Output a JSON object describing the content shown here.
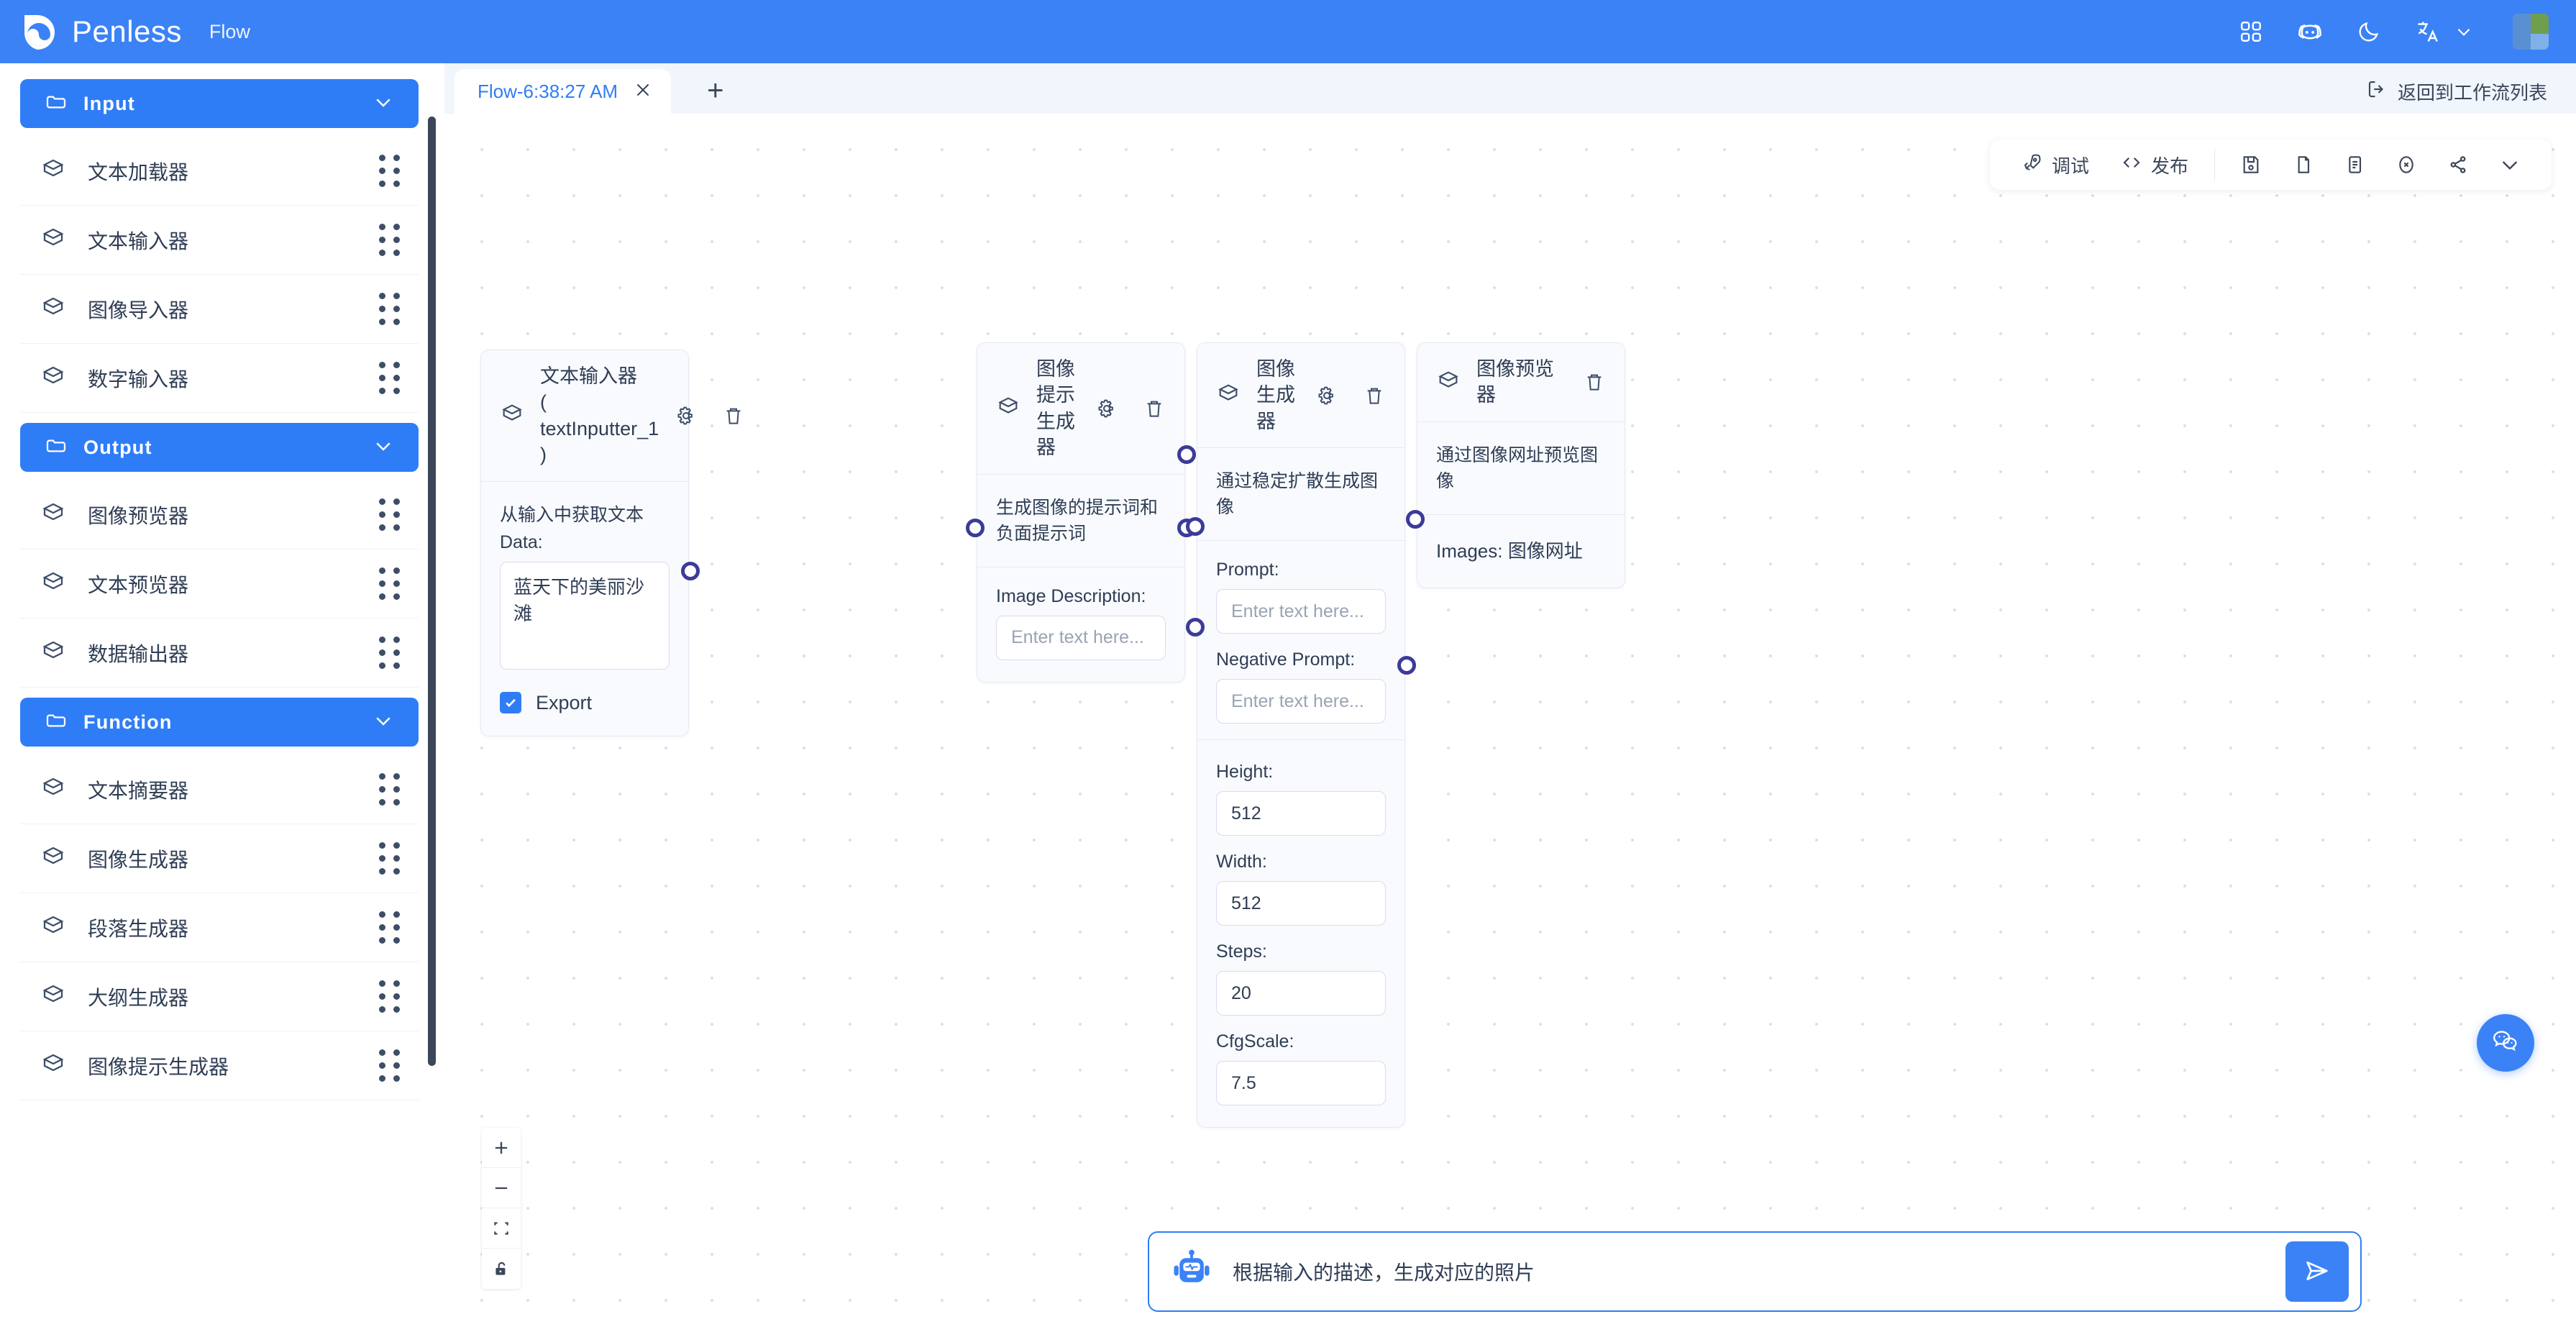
{
  "header": {
    "brand": "Penless",
    "product": "Flow",
    "icons": [
      "apps-grid-icon",
      "discord-icon",
      "dark-mode-moon-icon",
      "translate-icon",
      "chevron-down-icon",
      "user-avatar"
    ],
    "accent": "#3b82f6"
  },
  "sidebar": {
    "groups": [
      {
        "label": "Input",
        "items": [
          {
            "label": "文本加载器"
          },
          {
            "label": "文本输入器"
          },
          {
            "label": "图像导入器"
          },
          {
            "label": "数字输入器"
          }
        ]
      },
      {
        "label": "Output",
        "items": [
          {
            "label": "图像预览器"
          },
          {
            "label": "文本预览器"
          },
          {
            "label": "数据输出器"
          }
        ]
      },
      {
        "label": "Function",
        "items": [
          {
            "label": "文本摘要器"
          },
          {
            "label": "图像生成器"
          },
          {
            "label": "段落生成器"
          },
          {
            "label": "大纲生成器"
          },
          {
            "label": "图像提示生成器"
          }
        ]
      }
    ]
  },
  "tabs": {
    "items": [
      {
        "label": "Flow-6:38:27 AM"
      }
    ],
    "add_label": "+",
    "back_label": "返回到工作流列表"
  },
  "toolbar": {
    "debug_label": "调试",
    "publish_label": "发布",
    "icons": [
      "save-icon",
      "copy-icon",
      "paste-icon",
      "clear-icon",
      "share-icon",
      "chevron-down-icon"
    ]
  },
  "nodes": {
    "text_inputter": {
      "title": "文本输入器",
      "subtitle": "( textInputter_1 )",
      "description": "从输入中获取文本",
      "data_label": "Data:",
      "data_value": "蓝天下的美丽沙滩",
      "export_label": "Export"
    },
    "image_prompt_generator": {
      "title": "图像提示生成器",
      "description": "生成图像的提示词和负面提示词",
      "image_description_label": "Image Description:",
      "image_description_placeholder": "Enter text here..."
    },
    "image_generator": {
      "title": "图像生成器",
      "description": "通过稳定扩散生成图像",
      "prompt_label": "Prompt:",
      "prompt_placeholder": "Enter text here...",
      "negative_prompt_label": "Negative Prompt:",
      "negative_prompt_placeholder": "Enter text here...",
      "height_label": "Height:",
      "height_value": "512",
      "width_label": "Width:",
      "width_value": "512",
      "steps_label": "Steps:",
      "steps_value": "20",
      "cfgscale_label": "CfgScale:",
      "cfgscale_value": "7.5"
    },
    "image_previewer": {
      "title": "图像预览器",
      "description": "通过图像网址预览图像",
      "images_label": "Images: 图像网址"
    }
  },
  "canvas_controls": {
    "zoom_in": "zoom-in-icon",
    "zoom_out": "zoom-out-icon",
    "fit_view": "fit-view-icon",
    "lock": "lock-open-icon"
  },
  "chat": {
    "text": "根据输入的描述，生成对应的照片",
    "send_icon": "send-icon",
    "bot_icon": "robot-icon"
  },
  "fab": {
    "icon": "chat-bubbles-icon"
  }
}
